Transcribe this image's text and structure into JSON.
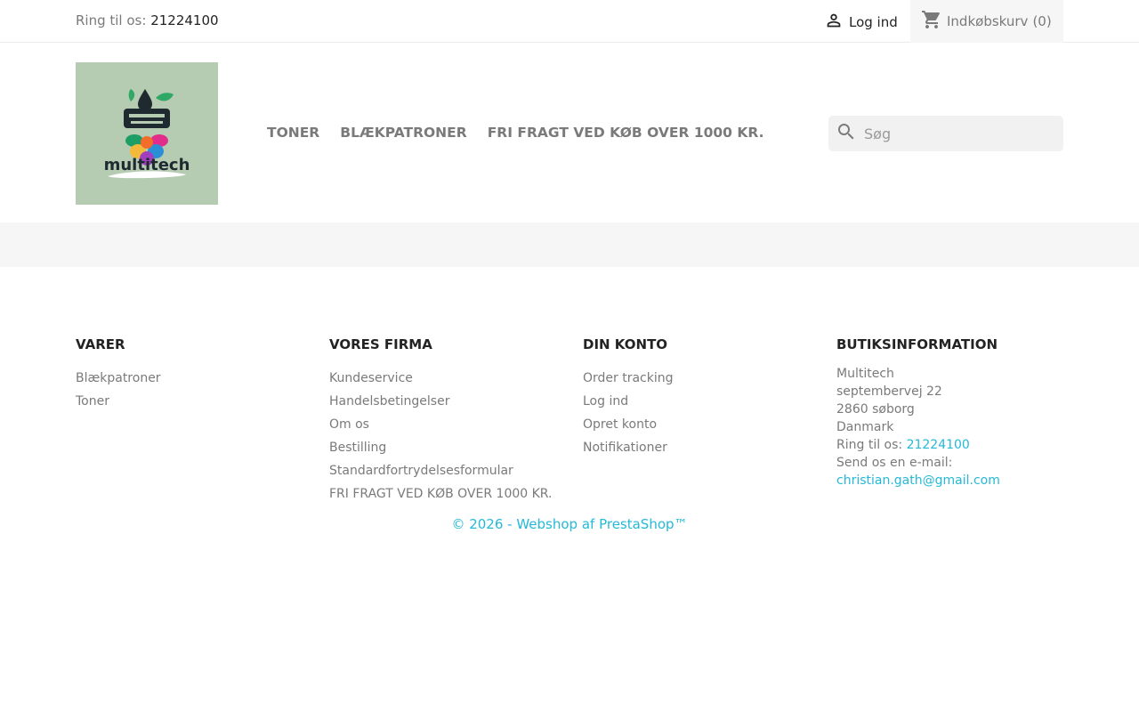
{
  "topbar": {
    "phone_label": "Ring til os:",
    "phone_number": "21224100",
    "login_label": "Log ind",
    "cart_label": "Indkøbskurv",
    "cart_count": "(0)"
  },
  "header": {
    "logo_text": "multitech",
    "nav": [
      {
        "label": "TONER"
      },
      {
        "label": "BLÆKPATRONER"
      },
      {
        "label": "FRI FRAGT VED KØB OVER 1000 KR."
      }
    ],
    "search_placeholder": "Søg"
  },
  "footer": {
    "products": {
      "title": "VARER",
      "items": [
        "Blækpatroner",
        "Toner"
      ]
    },
    "company": {
      "title": "VORES FIRMA",
      "items": [
        "Kundeservice",
        "Handelsbetingelser",
        "Om os",
        "Bestilling",
        "Standardfortrydelsesformular",
        "FRI FRAGT VED KØB OVER 1000 KR."
      ]
    },
    "account": {
      "title": "DIN KONTO",
      "items": [
        "Order tracking",
        "Log ind",
        "Opret konto",
        "Notifikationer"
      ]
    },
    "store": {
      "title": "BUTIKSINFORMATION",
      "name": "Multitech",
      "street": "septembervej 22",
      "city": "2860 søborg",
      "country": "Danmark",
      "phone_label": "Ring til os:",
      "phone": "21224100",
      "email_label": "Send os en e-mail:",
      "email": "christian.gath@gmail.com"
    },
    "copyright": "© 2026 - Webshop af PrestaShop™"
  },
  "colors": {
    "accent": "#24b9d7",
    "text": "#7a7a7a",
    "dark": "#232323"
  }
}
